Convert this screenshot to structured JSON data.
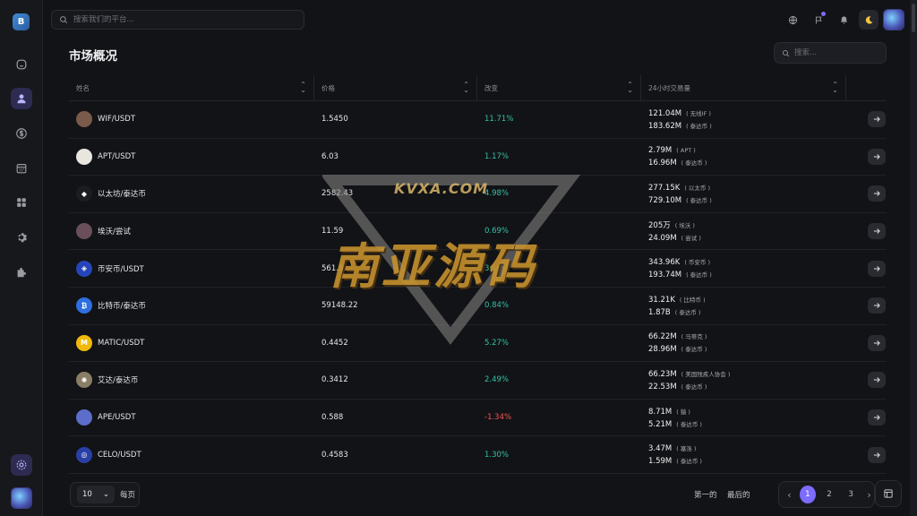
{
  "app": {
    "logo_letter": "B"
  },
  "search": {
    "placeholder": "搜索我们的平台..."
  },
  "page": {
    "title": "市场概况",
    "search_placeholder": "搜索..."
  },
  "table": {
    "columns": [
      "姓名",
      "价格",
      "改变",
      "24小时交易量"
    ],
    "rows": [
      {
        "pair": "WIF/USDT",
        "price": "1.5450",
        "change": "11.71%",
        "dir": "up",
        "vol1": "121.04M",
        "unit1": "( 无线IF )",
        "vol2": "183.62M",
        "unit2": "( 泰达币 )",
        "icon_color": "#7a5a4a",
        "glyph": ""
      },
      {
        "pair": "APT/USDT",
        "price": "6.03",
        "change": "1.17%",
        "dir": "up",
        "vol1": "2.79M",
        "unit1": "( APT )",
        "vol2": "16.96M",
        "unit2": "( 泰达币 )",
        "icon_color": "#e9e6df",
        "glyph": ""
      },
      {
        "pair": "以太坊/泰达币",
        "price": "2582.43",
        "change": "4.98%",
        "dir": "up",
        "vol1": "277.15K",
        "unit1": "( 以太币 )",
        "vol2": "729.10M",
        "unit2": "( 泰达币 )",
        "icon_color": "#1c1d22",
        "glyph": "◆"
      },
      {
        "pair": "埃沃/尝试",
        "price": "11.59",
        "change": "0.69%",
        "dir": "up",
        "vol1": "205万",
        "unit1": "( 埃沃 )",
        "vol2": "24.09M",
        "unit2": "( 尝试 )",
        "icon_color": "#6a4f5a",
        "glyph": ""
      },
      {
        "pair": "币安币/USDT",
        "price": "561.9",
        "change": "3.68%",
        "dir": "up",
        "vol1": "343.96K",
        "unit1": "( 币安币 )",
        "vol2": "193.74M",
        "unit2": "( 泰达币 )",
        "icon_color": "#2545b8",
        "glyph": "◈"
      },
      {
        "pair": "比特币/泰达币",
        "price": "59148.22",
        "change": "0.84%",
        "dir": "up",
        "vol1": "31.21K",
        "unit1": "( 比特币 )",
        "vol2": "1.87B",
        "unit2": "( 泰达币 )",
        "icon_color": "#2e6fe0",
        "glyph": "₿"
      },
      {
        "pair": "MATIC/USDT",
        "price": "0.4452",
        "change": "5.27%",
        "dir": "up",
        "vol1": "66.22M",
        "unit1": "( 马蒂克 )",
        "vol2": "28.96M",
        "unit2": "( 泰达币 )",
        "icon_color": "#f0b90b",
        "glyph": "M"
      },
      {
        "pair": "艾达/泰达币",
        "price": "0.3412",
        "change": "2.49%",
        "dir": "up",
        "vol1": "66.23M",
        "unit1": "( 美国残疾人协会 )",
        "vol2": "22.53M",
        "unit2": "( 泰达币 )",
        "icon_color": "#8a7d66",
        "glyph": "✺"
      },
      {
        "pair": "APE/USDT",
        "price": "0.588",
        "change": "-1.34%",
        "dir": "down",
        "vol1": "8.71M",
        "unit1": "( 猿 )",
        "vol2": "5.21M",
        "unit2": "( 泰达币 )",
        "icon_color": "#5c6ec9",
        "glyph": ""
      },
      {
        "pair": "CELO/USDT",
        "price": "0.4583",
        "change": "1.30%",
        "dir": "up",
        "vol1": "3.47M",
        "unit1": "( 塞洛 )",
        "vol2": "1.59M",
        "unit2": "( 泰达币 )",
        "icon_color": "#2a3fa6",
        "glyph": "◎"
      }
    ]
  },
  "footer": {
    "per_page_value": "10",
    "per_page_label": "每页",
    "first": "第一的",
    "last": "最后的",
    "pages": [
      "1",
      "2",
      "3"
    ]
  },
  "watermark": {
    "domain": "KVXA.COM",
    "text": "南亚源码"
  },
  "colors": {
    "accent": "#7c6cff",
    "up": "#34c0a8",
    "down": "#ef5a5a"
  }
}
